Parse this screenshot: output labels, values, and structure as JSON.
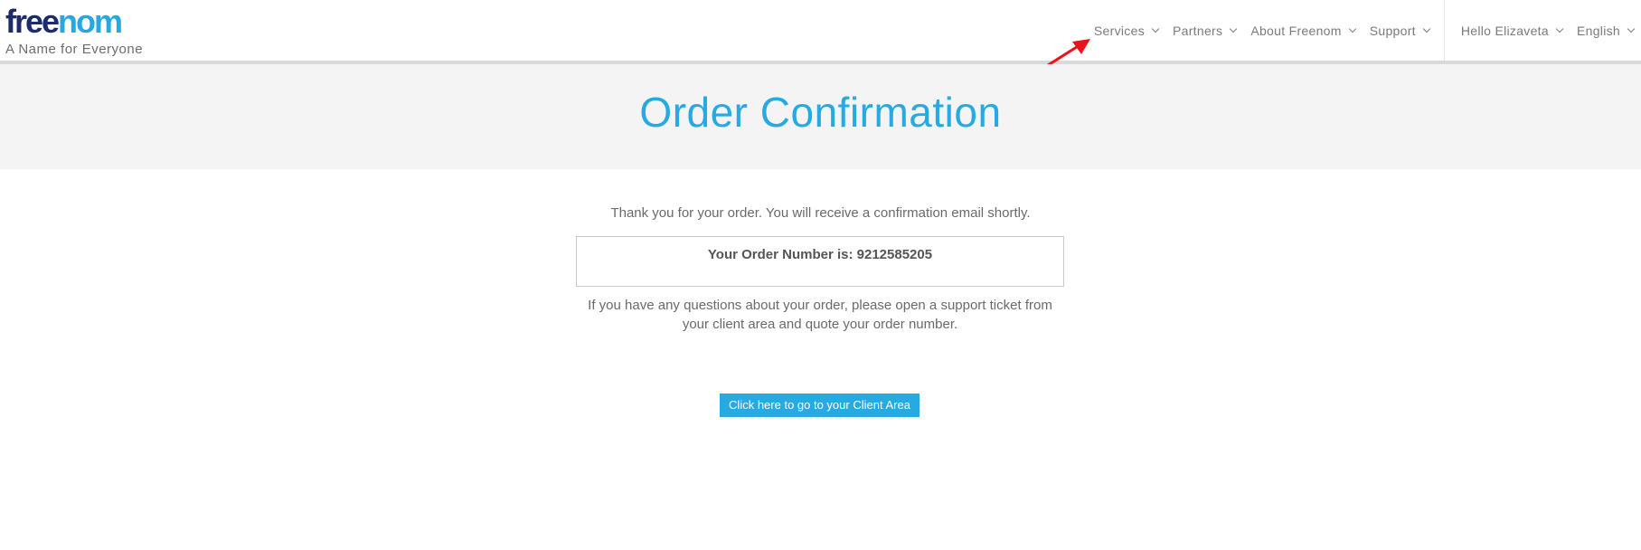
{
  "brand": {
    "logo_free": "free",
    "logo_nom": "nom",
    "tagline": "A Name for Everyone",
    "colors": {
      "dark": "#1d2a6b",
      "accent": "#26a9e0"
    }
  },
  "nav": {
    "services": "Services",
    "partners": "Partners",
    "about": "About Freenom",
    "support": "Support",
    "user": "Hello Elizaveta",
    "language": "English"
  },
  "banner": {
    "title": "Order Confirmation"
  },
  "confirmation": {
    "thanks": "Thank you for your order. You will receive a confirmation email shortly.",
    "order_number_label": "Your Order Number is: 9212585205",
    "questions": "If you have any questions about your order, please open a support ticket from your client area and quote your order number.",
    "client_area_button": "Click here to go to your Client Area"
  },
  "icons": {
    "chevron": "chevron-down-icon",
    "annotation": "red-arrow-annotation"
  }
}
